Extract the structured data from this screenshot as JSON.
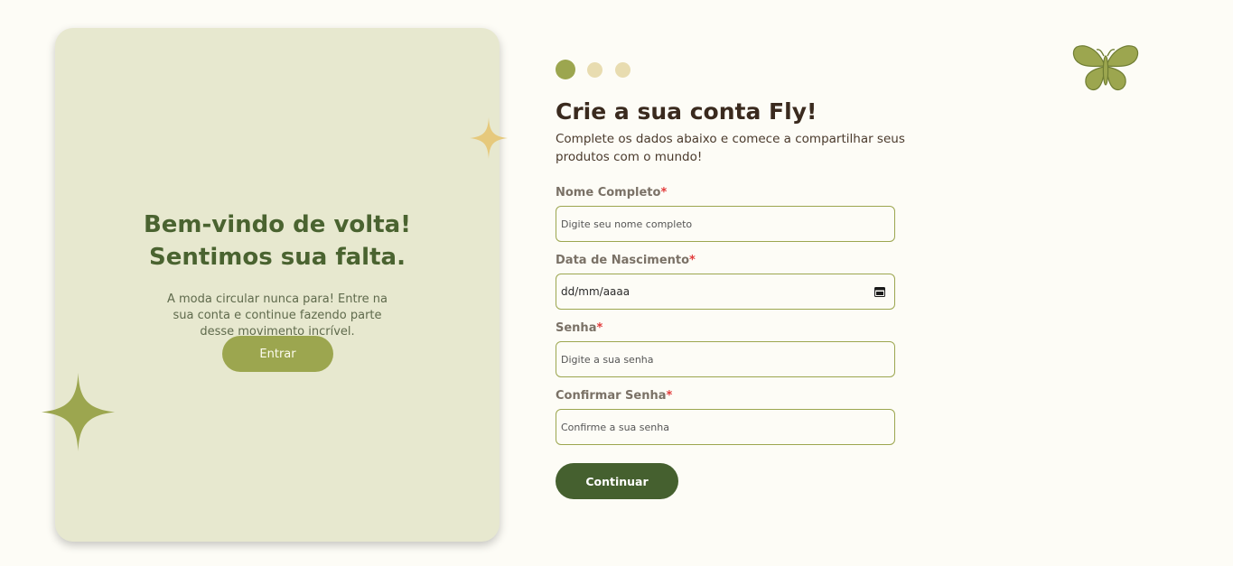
{
  "welcome": {
    "title_line1": "Bem-vindo de volta!",
    "title_line2": "Sentimos sua falta.",
    "text": "A moda circular nunca para! Entre na sua conta e continue fazendo parte desse movimento incrível.",
    "enter_label": "Entrar"
  },
  "steps": {
    "total": 3,
    "current": 1
  },
  "form": {
    "title": "Crie a sua conta Fly!",
    "subtitle": "Complete os dados abaixo e comece a compartilhar seus produtos com o mundo!",
    "required_mark": "*",
    "fields": [
      {
        "label": "Nome Completo",
        "placeholder": "Digite seu nome completo"
      },
      {
        "label": "Data de Nascimento",
        "value": "dd/mm/aaaa"
      },
      {
        "label": "Senha",
        "placeholder": "Digite a sua senha"
      },
      {
        "label": "Confirmar Senha",
        "placeholder": "Confirme a sua senha"
      }
    ],
    "continue_label": "Continuar"
  },
  "icons": {
    "logo": "butterfly-icon",
    "decor": "sparkle-icon",
    "date": "calendar-icon"
  },
  "colors": {
    "background": "#fdfcf6",
    "panel": "#e7e8cf",
    "accent": "#9ca64f",
    "primary": "#45602f",
    "heading": "#3a2a1e",
    "required": "#e23b3b",
    "dot_inactive": "#e8dcb0",
    "star_small": "#e6c97c"
  }
}
